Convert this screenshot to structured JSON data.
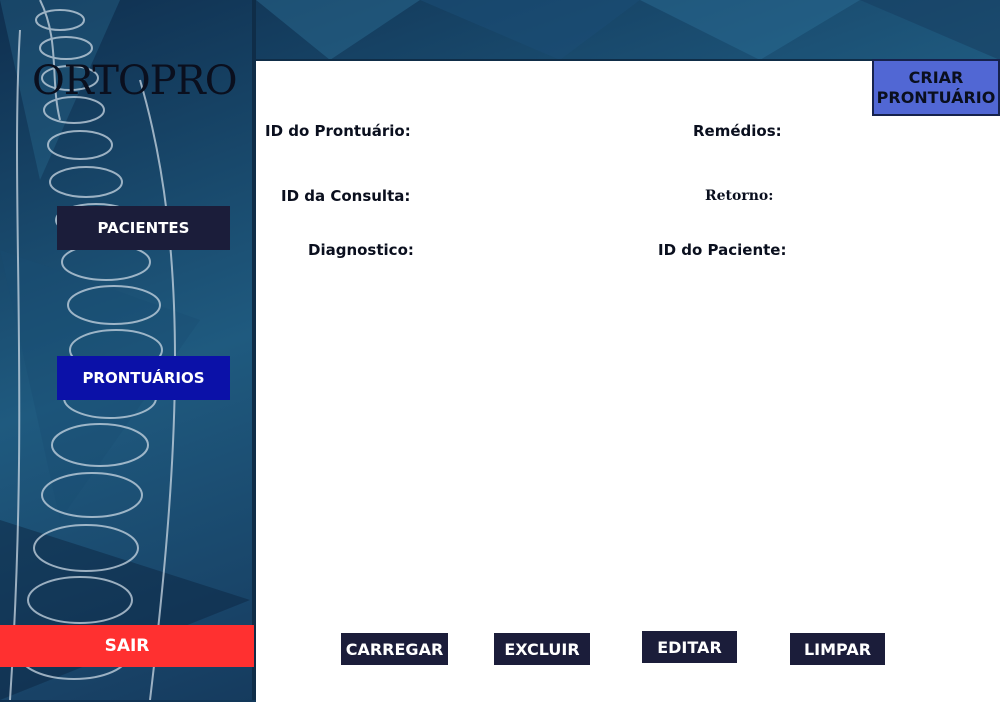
{
  "app": {
    "logo": "ORTOPRO"
  },
  "sidebar": {
    "pacientes_label": "PACIENTES",
    "prontuarios_label": "PRONTUÁRIOS",
    "sair_label": "SAIR"
  },
  "form": {
    "criar_label_line1": "CRIAR",
    "criar_label_line2": "PRONTUÁRIO",
    "id_prontuario_label": "ID do Prontuário:",
    "id_consulta_label": "ID da Consulta:",
    "diagnostico_label": "Diagnostico:",
    "remedios_label": "Remédios:",
    "retorno_label": "Retorno:",
    "id_paciente_label": "ID do Paciente:"
  },
  "actions": {
    "carregar_label": "CARREGAR",
    "excluir_label": "EXCLUIR",
    "editar_label": "EDITAR",
    "limpar_label": "LIMPAR"
  },
  "colors": {
    "nav_dark": "#1b1d3a",
    "nav_active": "#0b11a8",
    "exit_red": "#ff3030",
    "create_blue": "#5167d4"
  }
}
